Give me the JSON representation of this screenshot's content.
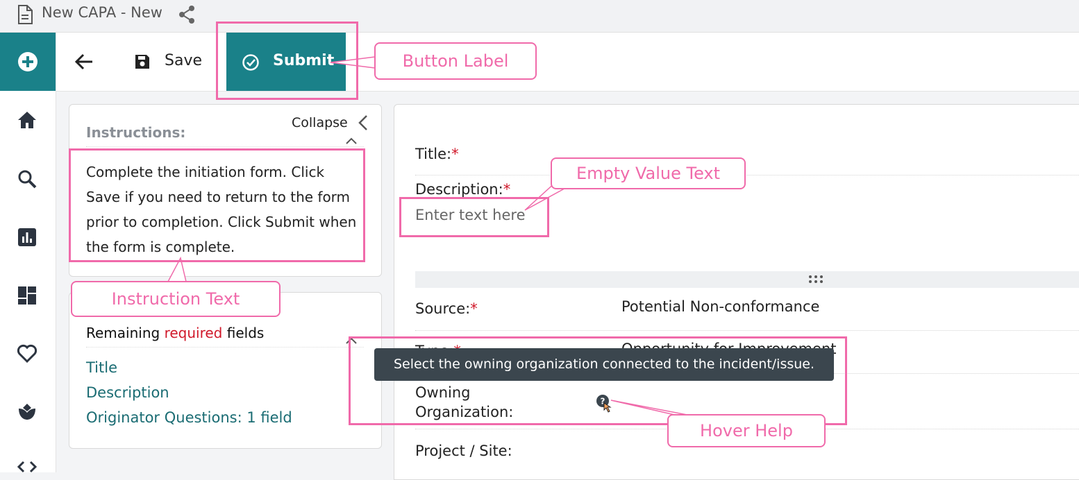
{
  "window": {
    "title": "New CAPA - New"
  },
  "toolbar": {
    "save_label": "Save",
    "submit_label": "Submit"
  },
  "instructions": {
    "heading": "Instructions:",
    "collapse_label": "Collapse",
    "text": "Complete the initiation form. Click Save if you need to return to the form prior to completion. Click Submit when the form is complete."
  },
  "required": {
    "prefix": "Remaining ",
    "keyword": "required",
    "suffix": " fields",
    "items": [
      "Title",
      "Description",
      "Originator Questions: 1 field"
    ]
  },
  "form": {
    "title_label": "Title:",
    "description_label": "Description:",
    "description_placeholder": "Enter text here",
    "source_label": "Source:",
    "source_value": "Potential Non-conformance",
    "type_label": "Type:",
    "type_value": "Opportunity for Improvement",
    "owning_org_label_1": "Owning",
    "owning_org_label_2": "Organization:",
    "project_label": "Project / Site:",
    "required_mark": "*"
  },
  "tooltip": {
    "text": "Select the owning organization connected to the incident/issue."
  },
  "annotations": {
    "button_label": "Button Label",
    "empty_value_text": "Empty Value Text",
    "instruction_text": "Instruction Text",
    "hover_help": "Hover Help"
  },
  "icons": [
    "document-icon",
    "share-icon",
    "add-icon",
    "home-icon",
    "search-icon",
    "chart-icon",
    "dashboard-icon",
    "heart-icon",
    "tulip-icon",
    "code-icon",
    "back-arrow-icon",
    "save-icon",
    "check-circle-icon",
    "chevron-left-icon",
    "chevron-up-icon",
    "drag-handle-icon",
    "help-icon"
  ],
  "colors": {
    "accent": "#1a8189",
    "annotation": "#f06aaa",
    "required": "#d0182a",
    "link": "#1a6c73"
  }
}
